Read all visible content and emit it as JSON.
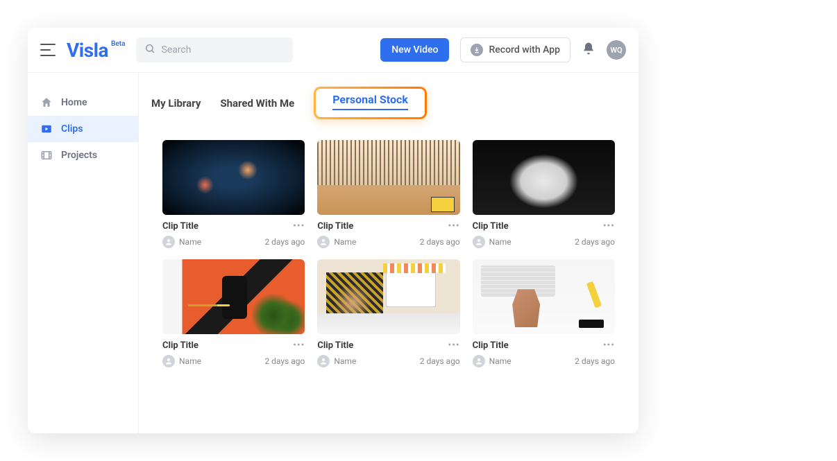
{
  "brand": {
    "name": "Visla",
    "tag": "Beta"
  },
  "header": {
    "search_placeholder": "Search",
    "new_video": "New Video",
    "record_app": "Record with App",
    "avatar_initials": "WQ"
  },
  "sidebar": {
    "items": [
      {
        "label": "Home",
        "active": false
      },
      {
        "label": "Clips",
        "active": true
      },
      {
        "label": "Projects",
        "active": false
      }
    ]
  },
  "tabs": [
    {
      "label": "My Library",
      "highlighted": false
    },
    {
      "label": "Shared With Me",
      "highlighted": false
    },
    {
      "label": "Personal Stock",
      "highlighted": true
    }
  ],
  "clips": [
    {
      "title": "Clip Title",
      "author": "Name",
      "time": "2 days ago"
    },
    {
      "title": "Clip Title",
      "author": "Name",
      "time": "2 days ago"
    },
    {
      "title": "Clip Title",
      "author": "Name",
      "time": "2 days ago"
    },
    {
      "title": "Clip Title",
      "author": "Name",
      "time": "2 days ago"
    },
    {
      "title": "Clip Title",
      "author": "Name",
      "time": "2 days ago"
    },
    {
      "title": "Clip Title",
      "author": "Name",
      "time": "2 days ago"
    }
  ]
}
